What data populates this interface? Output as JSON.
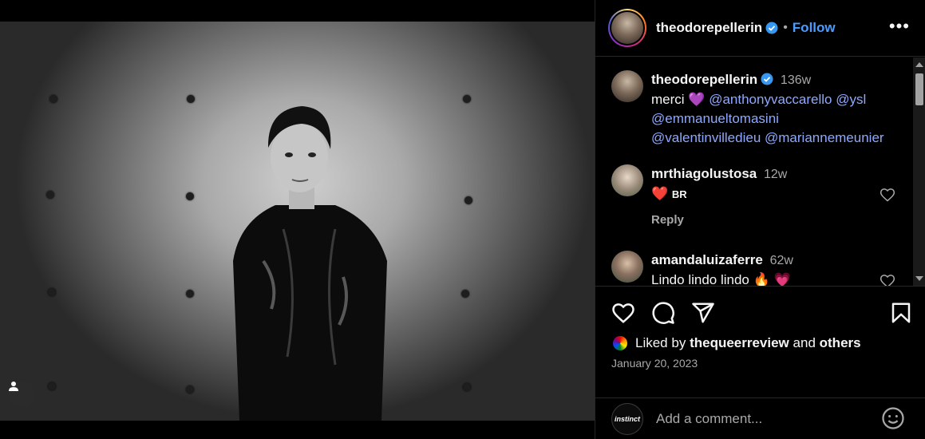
{
  "post": {
    "author": "theodorepellerin",
    "follow_label": "Follow",
    "dot": "•",
    "more_label": "•••"
  },
  "comments": [
    {
      "user": "theodorepellerin",
      "time": "136w",
      "text_prefix": "merci 💜",
      "mentions": [
        "@anthonyvaccarello",
        "@ysl",
        "@emmanueltomasini",
        "@valentinvilledieu",
        "@mariannemeunier"
      ]
    },
    {
      "user": "mrthiagolustosa",
      "time": "12w",
      "text": "❤️",
      "text_suffix": "BR",
      "reply_label": "Reply"
    },
    {
      "user": "amandaluizaferre",
      "time": "62w",
      "text": "Lindo lindo lindo 🔥 💗"
    }
  ],
  "likes": {
    "prefix": "Liked by",
    "user": "thequeerreview",
    "middle": "and",
    "others": "others"
  },
  "date": "January 20, 2023",
  "add_comment": {
    "placeholder": "Add a comment...",
    "avatar_text": "instinct"
  },
  "colors": {
    "accent": "#4a9cff",
    "mention": "#8ea8ff",
    "verified": "#3897f0"
  }
}
